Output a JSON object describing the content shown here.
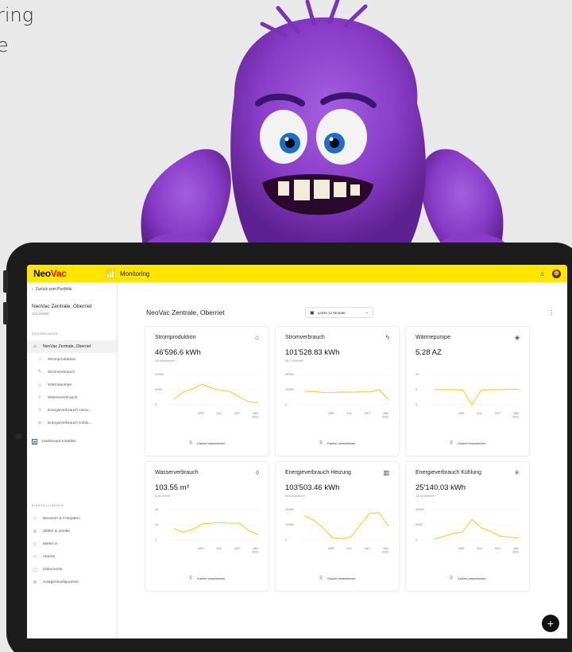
{
  "hero": {
    "line1": "ring",
    "line2": "e"
  },
  "app": {
    "logo_part1": "Neo",
    "logo_part2": "Vac",
    "title": "Monitoring",
    "brand_color": "#ffe500",
    "accent_red": "#e0161d"
  },
  "sidebar": {
    "back_label": "Zurück zum Portfolio",
    "title": "NeoVac Zentrale, Oberriet",
    "subtitle": "101-65254",
    "section_dashboards": "DASHBOARDS",
    "active_item": "NeoVac Zentrale, Oberriet",
    "items": [
      "Stromproduktion",
      "Stromverbrauch",
      "Wärmepumpe",
      "Wasserverbrauch",
      "Energieverbrauch Heizu...",
      "Energieverbrauch Kühlu..."
    ],
    "manage_label": "Dashboard erstellen",
    "section_settings": "EINSTELLUNGEN",
    "settings_items": [
      "Benutzer & Freigaben",
      "Zähler & Geräte",
      "Mieter:in",
      "Alarme",
      "Dokumente",
      "Anlagenkonfiguration"
    ]
  },
  "main": {
    "title": "NeoVac Zentrale, Oberriet",
    "period": "Letzte 12 Monate",
    "move_label": "Kachel verschieben"
  },
  "cards": [
    {
      "title": "Stromproduktion",
      "icon": "house-icon",
      "value": "46'596.6 kWh",
      "sub": "26.94 kWh/m²"
    },
    {
      "title": "Stromverbrauch",
      "icon": "bolt-icon",
      "value": "101'528.83 kWh",
      "sub": "58.7 kWh/m²"
    },
    {
      "title": "Wärmepumpe",
      "icon": "heatpump-icon",
      "value": "5.28 AZ",
      "sub": ""
    },
    {
      "title": "Wasserverbrauch",
      "icon": "drop-icon",
      "value": "103.55 m³",
      "sub": "0.06 m³/m²"
    },
    {
      "title": "Energieverbrauch Heizung",
      "icon": "radiator-icon",
      "value": "103'503.46 kWh",
      "sub": "59.84 kWh/m²"
    },
    {
      "title": "Energieverbrauch Kühlung",
      "icon": "snowflake-icon",
      "value": "25'140.03 kWh",
      "sub": "14.54 kWh/m²"
    }
  ],
  "chart_data": [
    {
      "type": "line",
      "title": "Stromproduktion",
      "x": [
        "APR",
        "JUL",
        "OKT",
        "JAN 2022"
      ],
      "yticks": [
        "10'000",
        "5'000",
        "0"
      ],
      "ylim": [
        0,
        10000
      ],
      "values": [
        1800,
        4200,
        5200,
        6800,
        5500,
        4700,
        4400,
        2600,
        900,
        700
      ]
    },
    {
      "type": "line",
      "title": "Stromverbrauch",
      "x": [
        "APR",
        "JUL",
        "OKT",
        "JAN 2022"
      ],
      "yticks": [
        "20'000",
        "10'000",
        "0"
      ],
      "ylim": [
        0,
        20000
      ],
      "values": [
        9000,
        8800,
        8200,
        8100,
        8400,
        8300,
        8600,
        8500,
        9800,
        3500
      ]
    },
    {
      "type": "line",
      "title": "Wärmepumpe",
      "x": [
        "APR",
        "JUL",
        "OKT",
        "JAN 2022"
      ],
      "yticks": [
        "10",
        "5",
        "0"
      ],
      "ylim": [
        0,
        10
      ],
      "values": [
        5.0,
        5.0,
        5.0,
        4.9,
        0.0,
        4.9,
        5.0,
        5.0,
        5.1,
        5.1
      ]
    },
    {
      "type": "line",
      "title": "Wasserverbrauch",
      "x": [
        "APR",
        "JUL",
        "OKT",
        "JAN 2022"
      ],
      "yticks": [
        "20",
        "10",
        "0"
      ],
      "ylim": [
        0,
        20
      ],
      "values": [
        7.5,
        5.0,
        7.0,
        10.5,
        11.0,
        11.5,
        11.0,
        11.0,
        6.0,
        3.5
      ]
    },
    {
      "type": "line",
      "title": "Energieverbrauch Heizung",
      "x": [
        "APR",
        "JUL",
        "OKT",
        "JAN 2022"
      ],
      "yticks": [
        "20'000",
        "10'000",
        "0"
      ],
      "ylim": [
        0,
        20000
      ],
      "values": [
        16000,
        13000,
        8000,
        1500,
        800,
        2000,
        10000,
        17500,
        18000,
        9000
      ]
    },
    {
      "type": "line",
      "title": "Energieverbrauch Kühlung",
      "x": [
        "APR",
        "JUL",
        "OKT",
        "JAN 2022"
      ],
      "yticks": [
        "10'000",
        "5'000",
        "0"
      ],
      "ylim": [
        0,
        10000
      ],
      "values": [
        300,
        1200,
        2100,
        2600,
        6800,
        4000,
        2800,
        1200,
        900,
        600
      ]
    }
  ]
}
